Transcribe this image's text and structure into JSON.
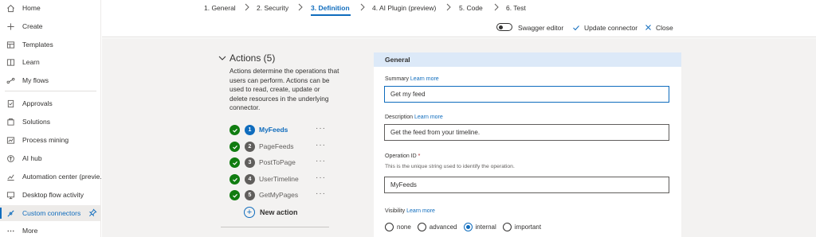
{
  "sidebar": {
    "items": [
      {
        "label": "Home",
        "icon": "home-icon"
      },
      {
        "label": "Create",
        "icon": "plus-icon"
      },
      {
        "label": "Templates",
        "icon": "templates-icon"
      },
      {
        "label": "Learn",
        "icon": "book-icon"
      },
      {
        "label": "My flows",
        "icon": "flow-icon"
      },
      {
        "label": "Approvals",
        "icon": "approvals-icon"
      },
      {
        "label": "Solutions",
        "icon": "solutions-icon"
      },
      {
        "label": "Process mining",
        "icon": "process-mining-icon"
      },
      {
        "label": "AI hub",
        "icon": "ai-hub-icon"
      },
      {
        "label": "Automation center (previe...",
        "icon": "automation-center-icon"
      },
      {
        "label": "Desktop flow activity",
        "icon": "desktop-flow-icon"
      },
      {
        "label": "Custom connectors",
        "icon": "custom-connectors-icon",
        "active": true
      },
      {
        "label": "More",
        "icon": "more-icon"
      }
    ]
  },
  "wizard": {
    "steps": [
      {
        "label": "1. General"
      },
      {
        "label": "2. Security"
      },
      {
        "label": "3. Definition",
        "active": true
      },
      {
        "label": "4. AI Plugin (preview)"
      },
      {
        "label": "5. Code"
      },
      {
        "label": "6. Test"
      }
    ]
  },
  "toolbar": {
    "swagger_label": "Swagger editor",
    "update_label": "Update connector",
    "close_label": "Close"
  },
  "actions": {
    "title": "Actions (5)",
    "description": "Actions determine the operations that users can perform. Actions can be used to read, create, update or delete resources in the underlying connector.",
    "items": [
      {
        "number": "1",
        "label": "MyFeeds",
        "active": true
      },
      {
        "number": "2",
        "label": "PageFeeds"
      },
      {
        "number": "3",
        "label": "PostToPage"
      },
      {
        "number": "4",
        "label": "UserTimeline"
      },
      {
        "number": "5",
        "label": "GetMyPages"
      }
    ],
    "more_label": "···",
    "new_action_label": "New action"
  },
  "general": {
    "header": "General",
    "summary": {
      "label": "Summary",
      "link": "Learn more",
      "value": "Get my feed"
    },
    "description": {
      "label": "Description",
      "link": "Learn more",
      "value": "Get the feed from your timeline."
    },
    "operation_id": {
      "label": "Operation ID",
      "required_mark": "*",
      "helper": "This is the unique string used to identify the operation.",
      "value": "MyFeeds"
    },
    "visibility": {
      "label": "Visibility",
      "link": "Learn more",
      "options": [
        "none",
        "advanced",
        "internal",
        "important"
      ],
      "selected": "internal"
    }
  },
  "colors": {
    "accent": "#0f6cbd",
    "success": "#107c10",
    "header_bg": "#dce9f8",
    "canvas_bg": "#f3f2f1"
  }
}
